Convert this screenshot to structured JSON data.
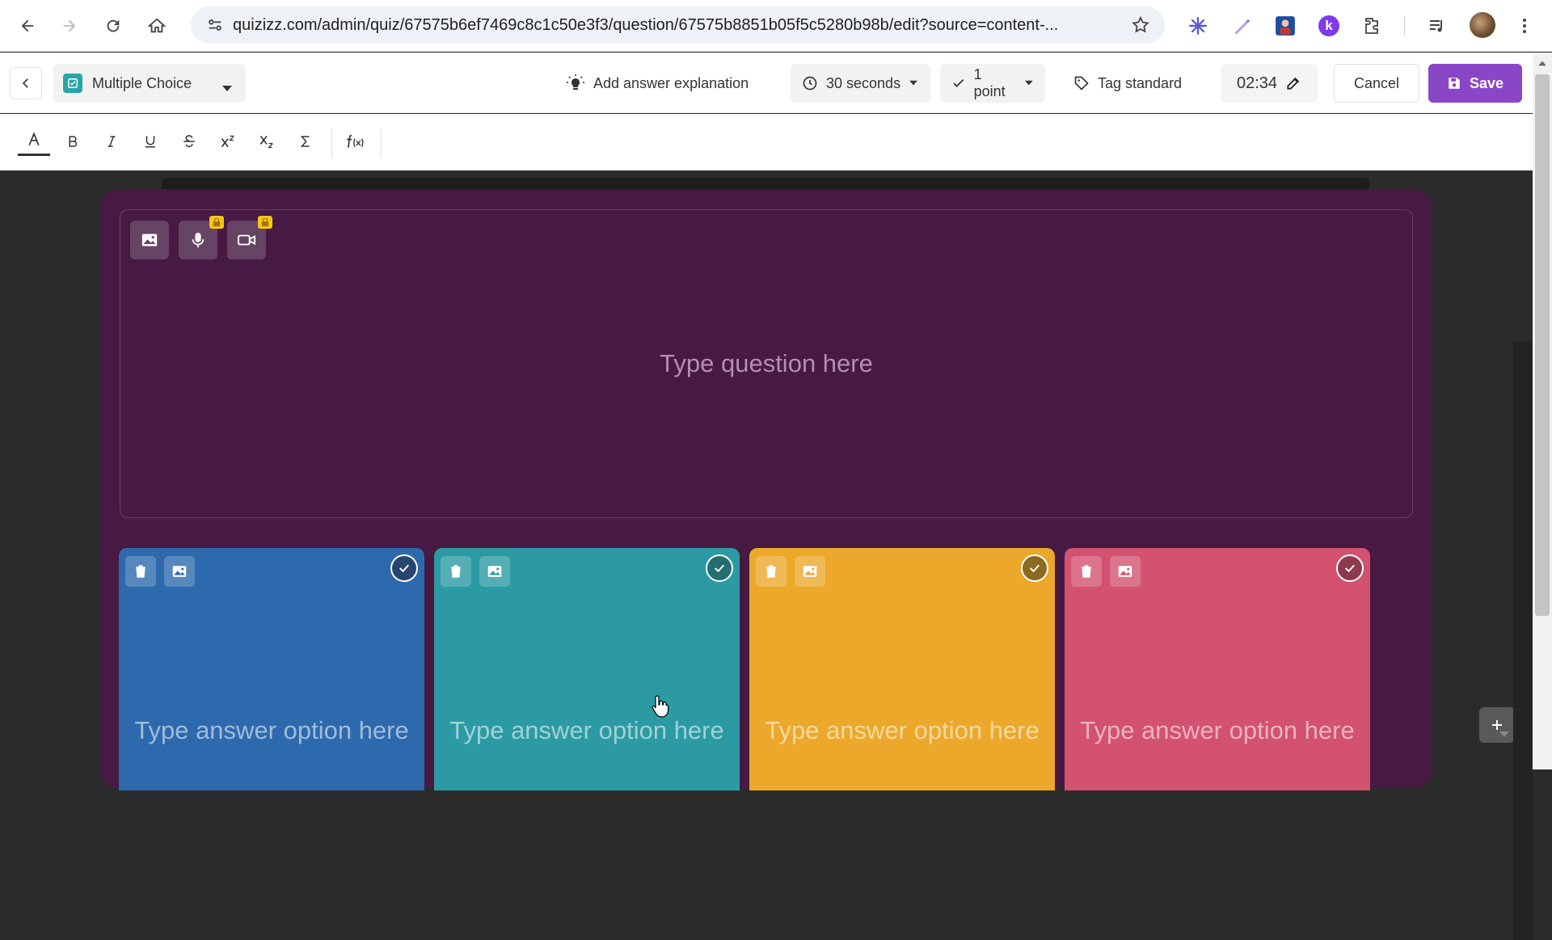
{
  "browser": {
    "url": "quizizz.com/admin/quiz/67575b6ef7469c8c1c50e3f3/question/67575b8851b05f5c5280b98b/edit?source=content-...",
    "extension_k": "k"
  },
  "appbar": {
    "question_type": "Multiple Choice",
    "explanation_label": "Add answer explanation",
    "time_label": "30 seconds",
    "points_label": "1 point",
    "tag_label": "Tag standard",
    "timer_value": "02:34",
    "cancel_label": "Cancel",
    "save_label": "Save"
  },
  "question": {
    "placeholder": "Type question here"
  },
  "options": [
    {
      "placeholder": "Type answer option here",
      "color": "#2d69ad"
    },
    {
      "placeholder": "Type answer option here",
      "color": "#2b9aa3"
    },
    {
      "placeholder": "Type answer option here",
      "color": "#eba82b"
    },
    {
      "placeholder": "Type answer option here",
      "color": "#d25270"
    }
  ],
  "colors": {
    "card_bg": "#461a42",
    "accent": "#8b46c7"
  }
}
